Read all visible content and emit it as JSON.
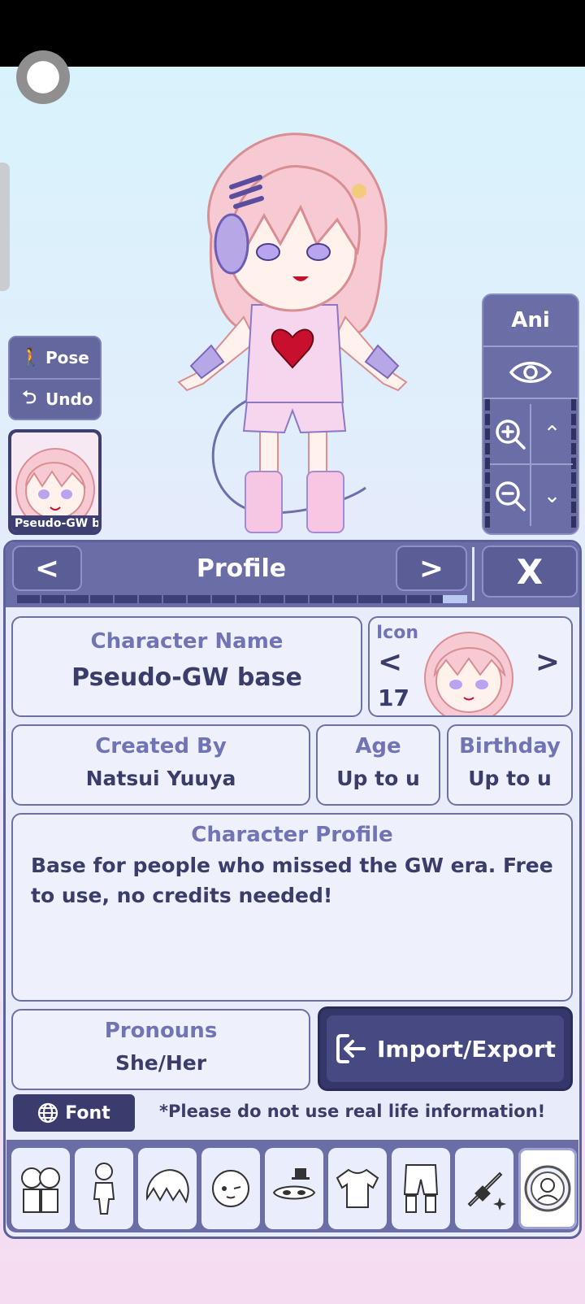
{
  "side_left": {
    "pose_label": "Pose",
    "undo_label": "Undo",
    "character_card_label": "Pseudo-GW base"
  },
  "side_right": {
    "ani_label": "Ani",
    "icons": [
      "eye-icon",
      "zoom-in-icon",
      "chevron-up-icon",
      "zoom-out-icon",
      "chevron-down-icon"
    ]
  },
  "profile": {
    "title": "Profile",
    "prev_label": "<",
    "next_label": ">",
    "close_label": "X",
    "character_name_label": "Character Name",
    "character_name": "Pseudo-GW base",
    "icon_label": "Icon",
    "icon_number": "17",
    "icon_prev": "<",
    "icon_next": ">",
    "created_by_label": "Created By",
    "created_by": "Natsui Yuuya",
    "age_label": "Age",
    "age": "Up to u",
    "birthday_label": "Birthday",
    "birthday": "Up to u",
    "character_profile_label": "Character Profile",
    "character_profile": "Base for people who missed the GW era. Free to use, no credits needed!",
    "pronouns_label": "Pronouns",
    "pronouns": "She/Her",
    "import_export_label": "Import/Export",
    "font_label": "Font",
    "note": "*Please do not use real life information!"
  },
  "tabs": [
    {
      "icon": "characters-icon"
    },
    {
      "icon": "body-icon"
    },
    {
      "icon": "hair-icon"
    },
    {
      "icon": "face-icon"
    },
    {
      "icon": "accessories-icon"
    },
    {
      "icon": "top-clothing-icon"
    },
    {
      "icon": "bottom-clothing-icon"
    },
    {
      "icon": "props-icon"
    },
    {
      "icon": "profile-icon"
    }
  ],
  "colors": {
    "panel_header": "#6b6ea6",
    "label_text": "#7074b4",
    "value_text": "#3a3c6a",
    "heart": "#c8102e"
  }
}
